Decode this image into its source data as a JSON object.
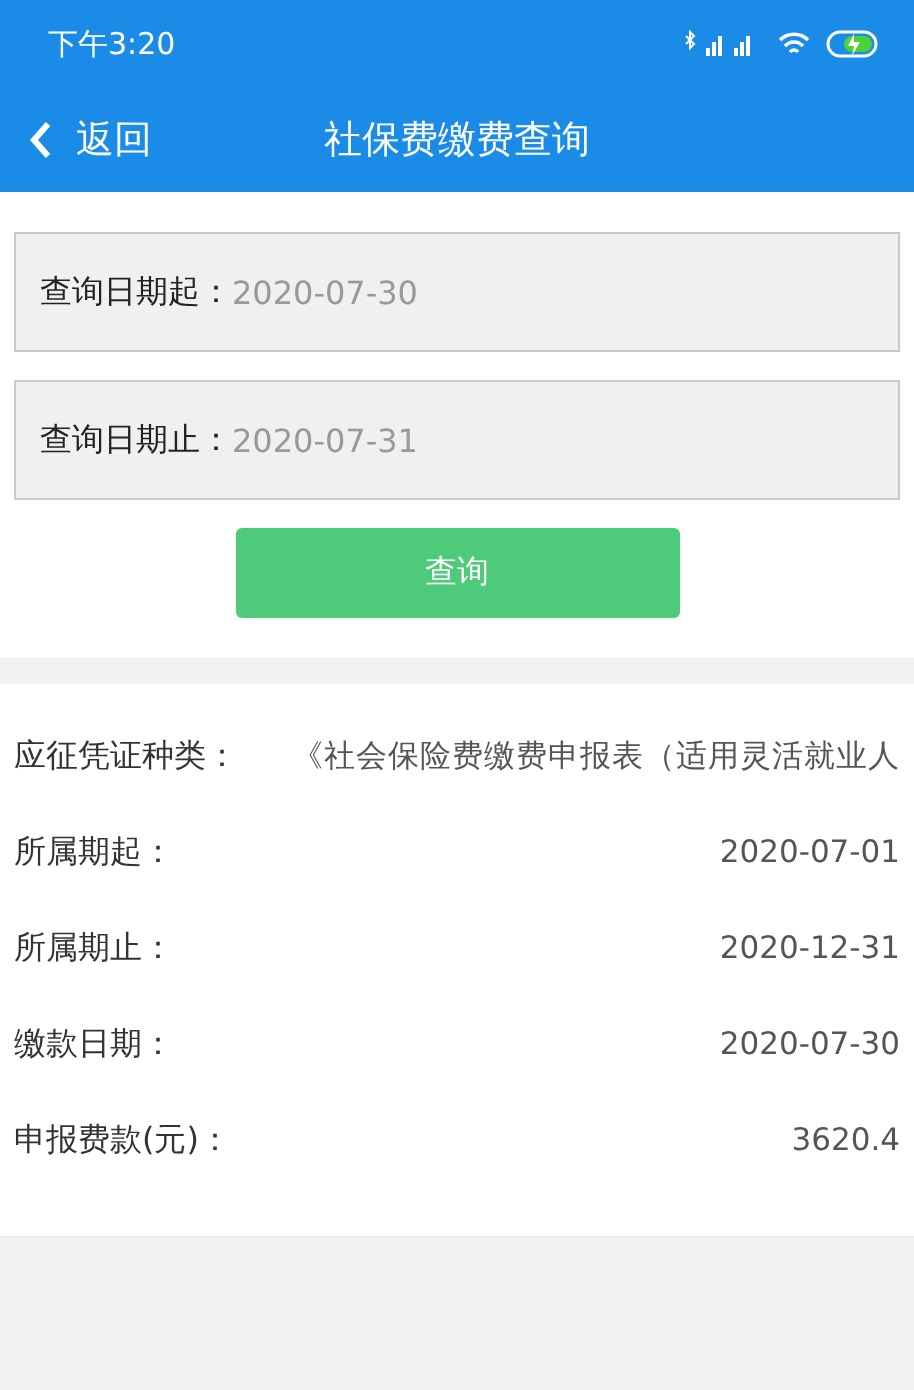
{
  "status_bar": {
    "time": "下午3:20"
  },
  "nav": {
    "back": "返回",
    "title": "社保费缴费查询"
  },
  "fields": [
    {
      "label": "查询日期起：",
      "value": "2020-07-30"
    },
    {
      "label": "查询日期止：",
      "value": "2020-07-31"
    }
  ],
  "query_button": "查询",
  "details": [
    {
      "label": "应征凭证种类：",
      "value": "《社会保险费缴费申报表（适用灵活就业人"
    },
    {
      "label": "所属期起：",
      "value": "2020-07-01"
    },
    {
      "label": "所属期止：",
      "value": "2020-12-31"
    },
    {
      "label": "缴款日期：",
      "value": "2020-07-30"
    },
    {
      "label": "申报费款(元)：",
      "value": "3620.4"
    }
  ]
}
